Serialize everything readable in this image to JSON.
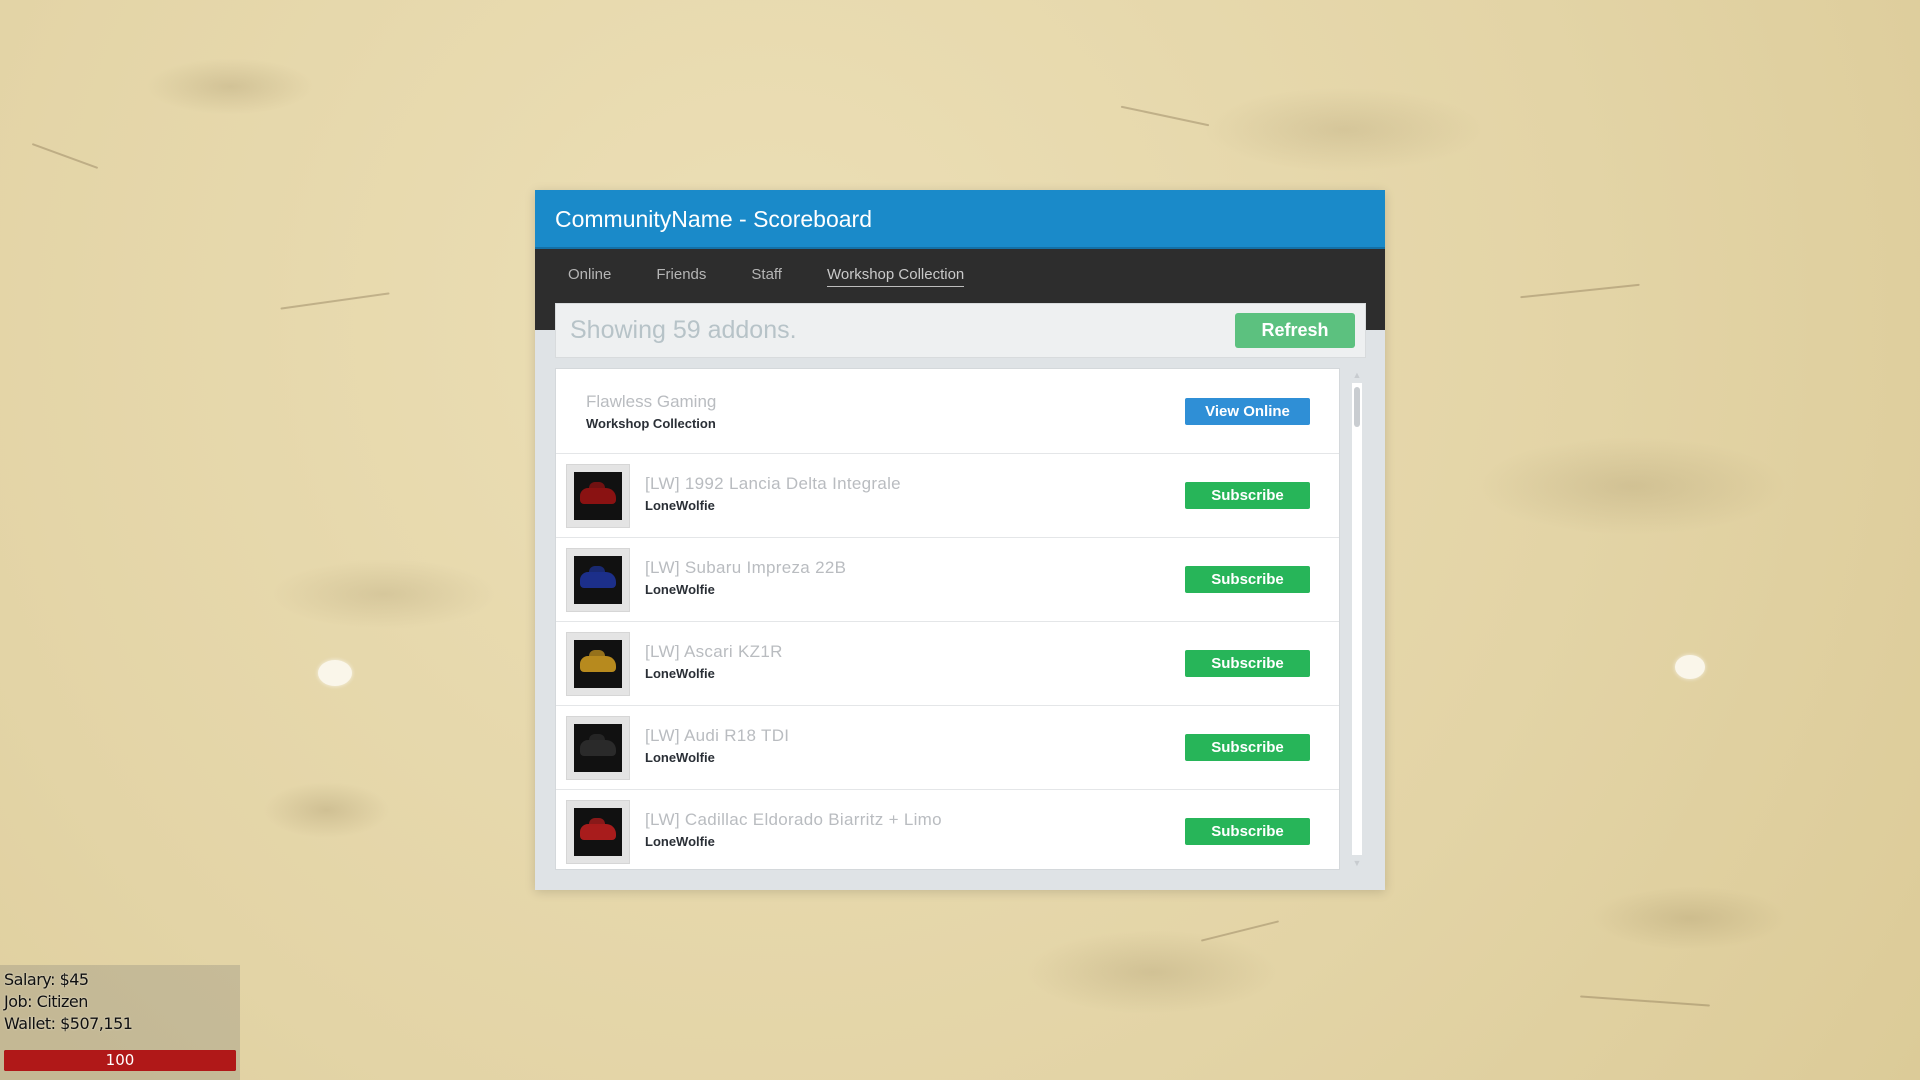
{
  "window": {
    "title": "CommunityName - Scoreboard",
    "tabs": [
      {
        "label": "Online"
      },
      {
        "label": "Friends"
      },
      {
        "label": "Staff"
      },
      {
        "label": "Workshop Collection"
      }
    ],
    "active_tab": "Workshop Collection",
    "info_text": "Showing 59 addons.",
    "refresh_label": "Refresh",
    "collection": {
      "title": "Flawless Gaming",
      "subtitle": "Workshop Collection",
      "button_label": "View Online"
    },
    "items": [
      {
        "title": "[LW] 1992 Lancia Delta Integrale",
        "author": "LoneWolfie",
        "button_label": "Subscribe",
        "thumb_color": "#8a1212"
      },
      {
        "title": "[LW] Subaru Impreza 22B",
        "author": "LoneWolfie",
        "button_label": "Subscribe",
        "thumb_color": "#1c2f8a"
      },
      {
        "title": "[LW] Ascari KZ1R",
        "author": "LoneWolfie",
        "button_label": "Subscribe",
        "thumb_color": "#b78a1e"
      },
      {
        "title": "[LW] Audi R18 TDI",
        "author": "LoneWolfie",
        "button_label": "Subscribe",
        "thumb_color": "#2a2a2a"
      },
      {
        "title": "[LW] Cadillac Eldorado Biarritz + Limo",
        "author": "LoneWolfie",
        "button_label": "Subscribe",
        "thumb_color": "#a81c1c"
      }
    ],
    "colors": {
      "title_bar": "#1a8ac9",
      "tab_bar": "#2d2d2d",
      "subscribe_button": "#27b559",
      "view_online_button": "#2f8fd6",
      "refresh_button": "#5cc17f"
    }
  },
  "hud": {
    "salary": "Salary: $45",
    "job": "Job: Citizen",
    "wallet": "Wallet: $507,151",
    "health": "100",
    "health_fraction": 1.0
  }
}
